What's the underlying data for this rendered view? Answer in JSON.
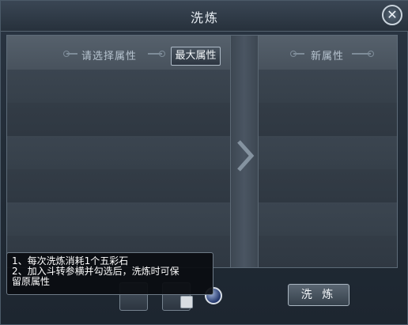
{
  "window": {
    "title": "洗炼",
    "close_icon": "close-icon"
  },
  "left_panel": {
    "header": "请选择属性",
    "max_attr_button": "最大属性"
  },
  "right_panel": {
    "header": "新属性"
  },
  "divider": {
    "icon": "chevron-right-icon"
  },
  "tooltip": {
    "lines": [
      "1、每次洗炼消耗1个五彩石",
      "2、加入斗转参横并勾选后，洗炼时可保\n留原属性"
    ]
  },
  "footer": {
    "wash_button": "洗 炼",
    "orb_icon": "blue-orb-icon"
  }
}
